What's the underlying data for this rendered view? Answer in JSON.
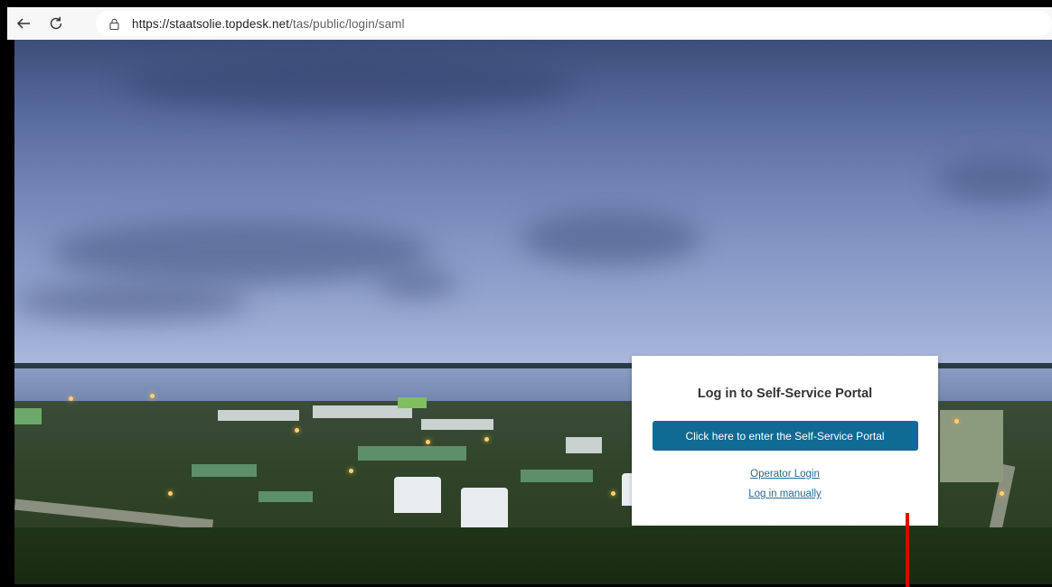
{
  "browser": {
    "url_host": "https://staatsolie.topdesk.net",
    "url_path": "/tas/public/login/saml",
    "icons": [
      "back-arrow-icon",
      "reload-icon",
      "lock-icon"
    ]
  },
  "login_card": {
    "title": "Log in to Self-Service Portal",
    "primary_button": "Click here to enter the Self-Service Portal",
    "operator_link": "Operator Login",
    "manual_link": "Log in manually",
    "primary_color": "#0f6b93",
    "link_color": "#2a6a8f"
  },
  "annotation": {
    "color": "#e00000"
  }
}
